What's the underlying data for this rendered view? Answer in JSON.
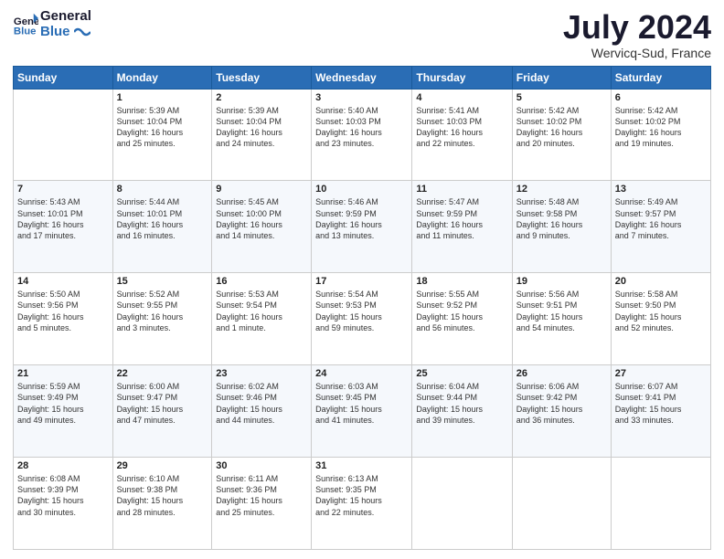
{
  "header": {
    "logo_line1": "General",
    "logo_line2": "Blue",
    "month_year": "July 2024",
    "location": "Wervicq-Sud, France"
  },
  "weekdays": [
    "Sunday",
    "Monday",
    "Tuesday",
    "Wednesday",
    "Thursday",
    "Friday",
    "Saturday"
  ],
  "weeks": [
    [
      {
        "day": "",
        "content": ""
      },
      {
        "day": "1",
        "content": "Sunrise: 5:39 AM\nSunset: 10:04 PM\nDaylight: 16 hours\nand 25 minutes."
      },
      {
        "day": "2",
        "content": "Sunrise: 5:39 AM\nSunset: 10:04 PM\nDaylight: 16 hours\nand 24 minutes."
      },
      {
        "day": "3",
        "content": "Sunrise: 5:40 AM\nSunset: 10:03 PM\nDaylight: 16 hours\nand 23 minutes."
      },
      {
        "day": "4",
        "content": "Sunrise: 5:41 AM\nSunset: 10:03 PM\nDaylight: 16 hours\nand 22 minutes."
      },
      {
        "day": "5",
        "content": "Sunrise: 5:42 AM\nSunset: 10:02 PM\nDaylight: 16 hours\nand 20 minutes."
      },
      {
        "day": "6",
        "content": "Sunrise: 5:42 AM\nSunset: 10:02 PM\nDaylight: 16 hours\nand 19 minutes."
      }
    ],
    [
      {
        "day": "7",
        "content": "Sunrise: 5:43 AM\nSunset: 10:01 PM\nDaylight: 16 hours\nand 17 minutes."
      },
      {
        "day": "8",
        "content": "Sunrise: 5:44 AM\nSunset: 10:01 PM\nDaylight: 16 hours\nand 16 minutes."
      },
      {
        "day": "9",
        "content": "Sunrise: 5:45 AM\nSunset: 10:00 PM\nDaylight: 16 hours\nand 14 minutes."
      },
      {
        "day": "10",
        "content": "Sunrise: 5:46 AM\nSunset: 9:59 PM\nDaylight: 16 hours\nand 13 minutes."
      },
      {
        "day": "11",
        "content": "Sunrise: 5:47 AM\nSunset: 9:59 PM\nDaylight: 16 hours\nand 11 minutes."
      },
      {
        "day": "12",
        "content": "Sunrise: 5:48 AM\nSunset: 9:58 PM\nDaylight: 16 hours\nand 9 minutes."
      },
      {
        "day": "13",
        "content": "Sunrise: 5:49 AM\nSunset: 9:57 PM\nDaylight: 16 hours\nand 7 minutes."
      }
    ],
    [
      {
        "day": "14",
        "content": "Sunrise: 5:50 AM\nSunset: 9:56 PM\nDaylight: 16 hours\nand 5 minutes."
      },
      {
        "day": "15",
        "content": "Sunrise: 5:52 AM\nSunset: 9:55 PM\nDaylight: 16 hours\nand 3 minutes."
      },
      {
        "day": "16",
        "content": "Sunrise: 5:53 AM\nSunset: 9:54 PM\nDaylight: 16 hours\nand 1 minute."
      },
      {
        "day": "17",
        "content": "Sunrise: 5:54 AM\nSunset: 9:53 PM\nDaylight: 15 hours\nand 59 minutes."
      },
      {
        "day": "18",
        "content": "Sunrise: 5:55 AM\nSunset: 9:52 PM\nDaylight: 15 hours\nand 56 minutes."
      },
      {
        "day": "19",
        "content": "Sunrise: 5:56 AM\nSunset: 9:51 PM\nDaylight: 15 hours\nand 54 minutes."
      },
      {
        "day": "20",
        "content": "Sunrise: 5:58 AM\nSunset: 9:50 PM\nDaylight: 15 hours\nand 52 minutes."
      }
    ],
    [
      {
        "day": "21",
        "content": "Sunrise: 5:59 AM\nSunset: 9:49 PM\nDaylight: 15 hours\nand 49 minutes."
      },
      {
        "day": "22",
        "content": "Sunrise: 6:00 AM\nSunset: 9:47 PM\nDaylight: 15 hours\nand 47 minutes."
      },
      {
        "day": "23",
        "content": "Sunrise: 6:02 AM\nSunset: 9:46 PM\nDaylight: 15 hours\nand 44 minutes."
      },
      {
        "day": "24",
        "content": "Sunrise: 6:03 AM\nSunset: 9:45 PM\nDaylight: 15 hours\nand 41 minutes."
      },
      {
        "day": "25",
        "content": "Sunrise: 6:04 AM\nSunset: 9:44 PM\nDaylight: 15 hours\nand 39 minutes."
      },
      {
        "day": "26",
        "content": "Sunrise: 6:06 AM\nSunset: 9:42 PM\nDaylight: 15 hours\nand 36 minutes."
      },
      {
        "day": "27",
        "content": "Sunrise: 6:07 AM\nSunset: 9:41 PM\nDaylight: 15 hours\nand 33 minutes."
      }
    ],
    [
      {
        "day": "28",
        "content": "Sunrise: 6:08 AM\nSunset: 9:39 PM\nDaylight: 15 hours\nand 30 minutes."
      },
      {
        "day": "29",
        "content": "Sunrise: 6:10 AM\nSunset: 9:38 PM\nDaylight: 15 hours\nand 28 minutes."
      },
      {
        "day": "30",
        "content": "Sunrise: 6:11 AM\nSunset: 9:36 PM\nDaylight: 15 hours\nand 25 minutes."
      },
      {
        "day": "31",
        "content": "Sunrise: 6:13 AM\nSunset: 9:35 PM\nDaylight: 15 hours\nand 22 minutes."
      },
      {
        "day": "",
        "content": ""
      },
      {
        "day": "",
        "content": ""
      },
      {
        "day": "",
        "content": ""
      }
    ]
  ]
}
